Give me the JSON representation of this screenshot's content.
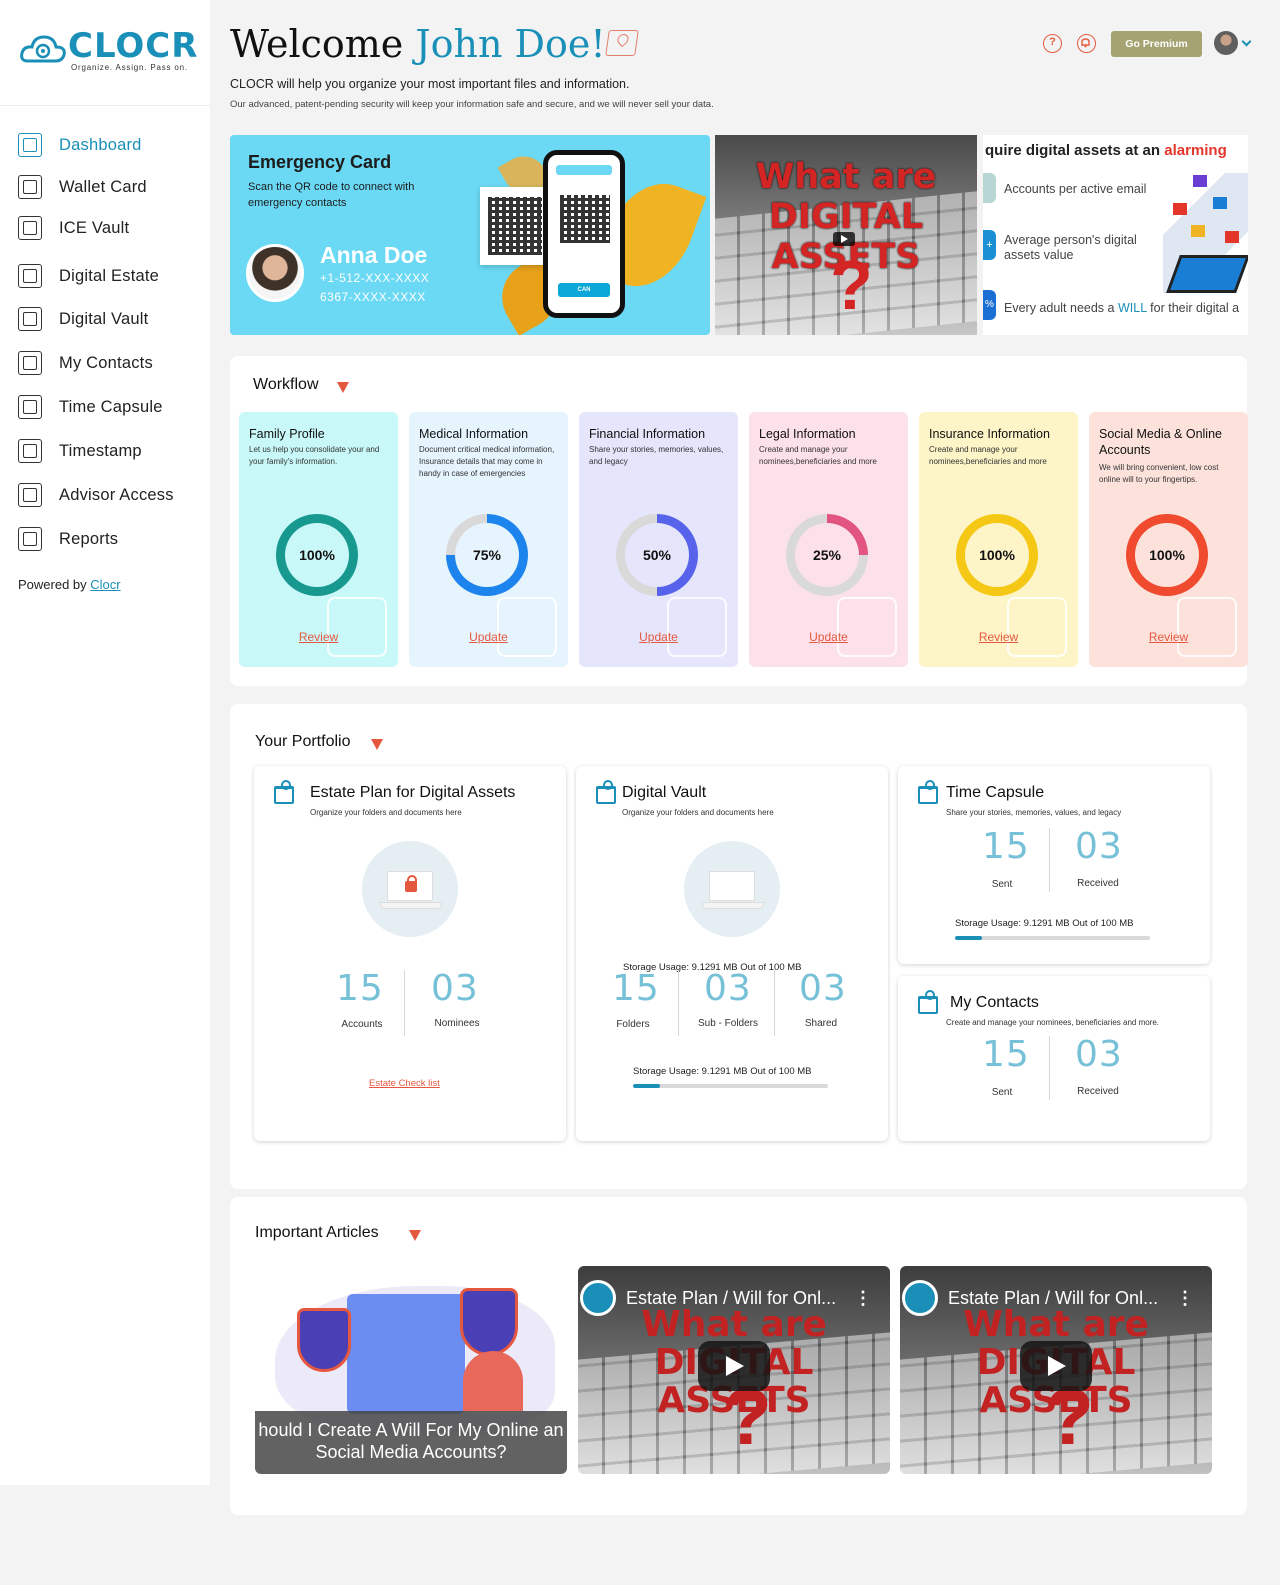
{
  "brand": {
    "name": "CLOCR",
    "tagline": "Organize. Assign. Pass on."
  },
  "sidebar": {
    "items": [
      {
        "label": "Dashboard",
        "icon": "dashboard-icon",
        "active": true
      },
      {
        "label": "Wallet Card",
        "icon": "qr-code-icon"
      },
      {
        "label": "ICE Vault",
        "icon": "ice-vault-icon"
      },
      {
        "label": "Digital Estate",
        "icon": "digital-estate-icon"
      },
      {
        "label": "Digital Vault",
        "icon": "safe-icon"
      },
      {
        "label": "My Contacts",
        "icon": "contacts-icon"
      },
      {
        "label": "Time Capsule",
        "icon": "time-capsule-icon"
      },
      {
        "label": "Timestamp",
        "icon": "timestamp-icon"
      },
      {
        "label": "Advisor Access",
        "icon": "advisor-icon"
      },
      {
        "label": "Reports",
        "icon": "reports-icon"
      }
    ],
    "powered_prefix": "Powered by",
    "powered_link": "Clocr"
  },
  "header": {
    "welcome": "Welcome",
    "user_name": "John Doe!",
    "sub1": "CLOCR will help you organize your most important files and information.",
    "sub2": "Our advanced, patent-pending security will keep your information safe and secure, and we will never sell your data.",
    "help": "?",
    "premium_label": "Go Premium",
    "premium_color": "#a4a371",
    "accent_color": "#1a90b8"
  },
  "emergency": {
    "title": "Emergency Card",
    "desc": "Scan the QR code to connect with emergency contacts",
    "name": "Anna Doe",
    "phone": "+1-512-XXX-XXXX",
    "id": "6367-XXXX-XXXX",
    "scan_btn": "CAN"
  },
  "video_banner": {
    "line1": "What are",
    "line2": "DIGITAL ASSETS",
    "q": "?"
  },
  "infographic": {
    "title_pre": "quire digital assets at an ",
    "title_alarm": "alarming",
    "row1": "Accounts per active email",
    "row2": "Average person's digital assets value",
    "row2_tag": "+",
    "row3_pre": "Every adult needs a ",
    "row3_will": "WILL",
    "row3_post": " for their digital a",
    "row3_tag": "%"
  },
  "workflow": {
    "title": "Workflow",
    "cards": [
      {
        "title": "Family Profile",
        "desc": "Let us help you consolidate your and your family's information.",
        "percent": 100,
        "percent_label": "100%",
        "action": "Review",
        "bg": "#c9f8f8",
        "color": "#17998f"
      },
      {
        "title": "Medical Information",
        "desc": "Document critical medical information, Insurance details that may come in handy in case of emergencies",
        "percent": 75,
        "percent_label": "75%",
        "action": "Update",
        "bg": "#e6f4fe",
        "color": "#1d84ee"
      },
      {
        "title": "Financial Information",
        "desc": "Share your stories, memories, values, and legacy",
        "percent": 50,
        "percent_label": "50%",
        "action": "Update",
        "bg": "#e5e5fb",
        "color": "#5763ea"
      },
      {
        "title": "Legal Information",
        "desc": "Create and manage your nominees,beneficiaries and more",
        "percent": 25,
        "percent_label": "25%",
        "action": "Update",
        "bg": "#fde1ea",
        "color": "#e25580"
      },
      {
        "title": "Insurance Information",
        "desc": "Create and manage your nominees,beneficiaries and more",
        "percent": 100,
        "percent_label": "100%",
        "action": "Review",
        "bg": "#fdf4c7",
        "color": "#f5c815"
      },
      {
        "title": "Social Media & Online Accounts",
        "desc": "We will bring convenient, low cost online will to your fingertips.",
        "percent": 100,
        "percent_label": "100%",
        "action": "Review",
        "bg": "#fde2dc",
        "color": "#f04a2f"
      }
    ]
  },
  "portfolio": {
    "title": "Your Portfolio",
    "estate": {
      "title": "Estate Plan for Digital Assets",
      "sub": "Organize your folders and documents here",
      "accounts": "15",
      "accounts_label": "Accounts",
      "nominees": "03",
      "nominees_label": "Nominees",
      "link": "Estate Check list"
    },
    "vault": {
      "title": "Digital Vault",
      "sub": "Organize your folders and documents here",
      "storage_top": "Storage Usage: 9.1291 MB Out of 100 MB",
      "folders": "15",
      "folders_label": "Folders",
      "subfolders": "03",
      "subfolders_label": "Sub - Folders",
      "shared": "03",
      "shared_label": "Shared",
      "storage_bottom": "Storage Usage: 9.1291 MB Out of 100 MB",
      "usage_fraction": 0.14
    },
    "capsule": {
      "title": "Time Capsule",
      "sub": "Share your stories, memories, values, and legacy",
      "sent": "15",
      "sent_label": "Sent",
      "received": "03",
      "received_label": "Received",
      "storage": "Storage Usage: 9.1291 MB Out of 100 MB",
      "usage_fraction": 0.14
    },
    "contacts": {
      "title": "My Contacts",
      "sub": "Create and manage your nominees, beneficiaries and more.",
      "sent": "15",
      "sent_label": "Sent",
      "received": "03",
      "received_label": "Received"
    }
  },
  "articles": {
    "title": "Important Articles",
    "items": [
      {
        "caption_line1": "hould I Create A Will For My Online an",
        "caption_line2": "Social Media Accounts?"
      },
      {
        "video_title": "Estate Plan / Will for Onl...",
        "wm1": "What are",
        "wm2": "DIGITAL ASSETS",
        "q": "?"
      },
      {
        "video_title": "Estate Plan / Will for Onl...",
        "wm1": "What are",
        "wm2": "DIGITAL ASSETS",
        "q": "?"
      }
    ]
  }
}
